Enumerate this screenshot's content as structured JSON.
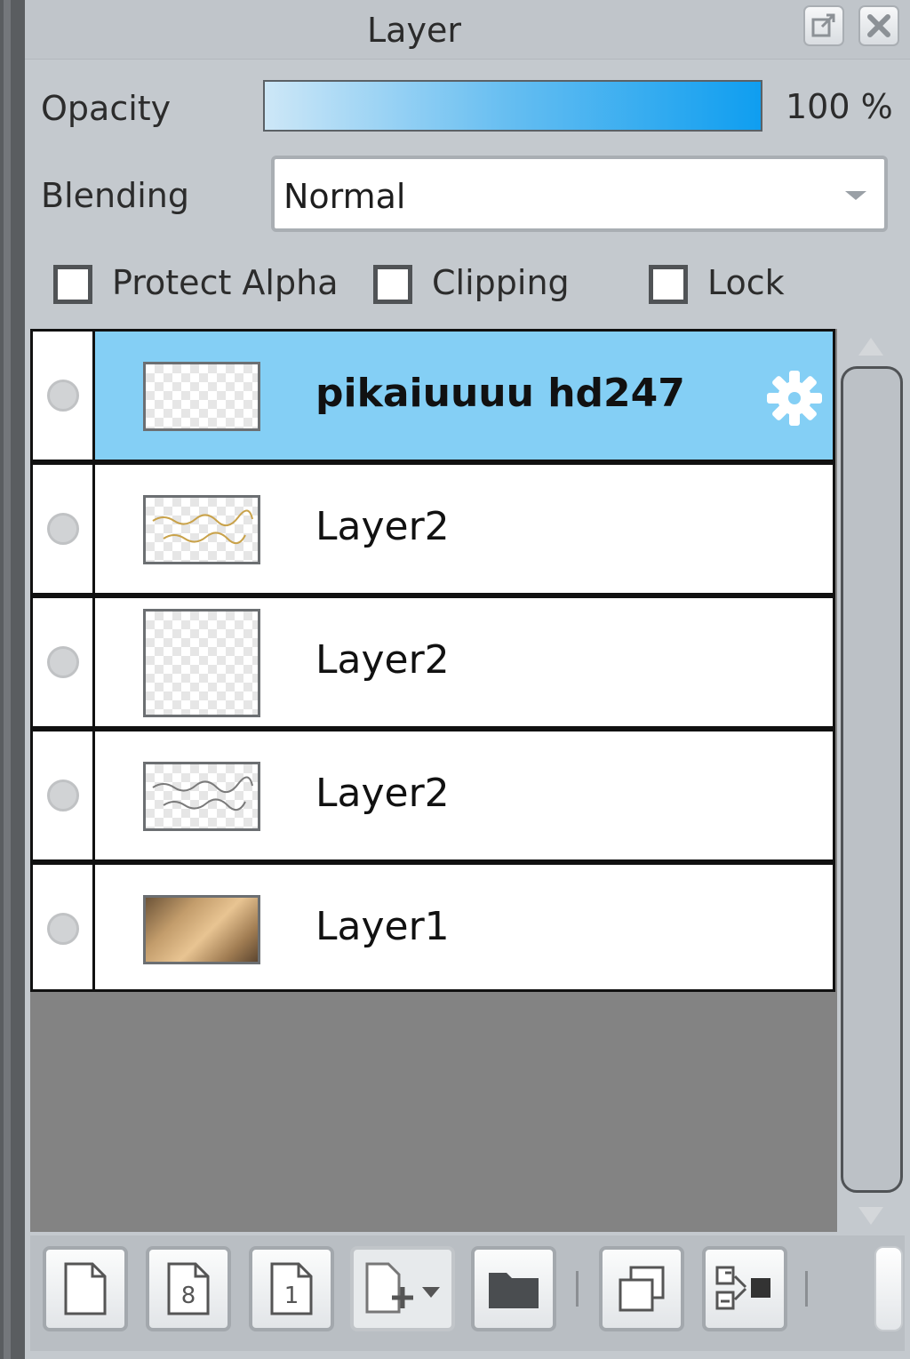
{
  "panel": {
    "title": "Layer",
    "popout_icon": "popout-icon",
    "close_icon": "close-icon"
  },
  "opacity": {
    "label": "Opacity",
    "value_text": "100 %",
    "percent": 100
  },
  "blending": {
    "label": "Blending",
    "selected": "Normal"
  },
  "options": {
    "protect_alpha": {
      "label": "Protect Alpha",
      "checked": false
    },
    "clipping": {
      "label": "Clipping",
      "checked": false
    },
    "lock": {
      "label": "Lock",
      "checked": false
    }
  },
  "layers": [
    {
      "name": "pikaiuuuu hd247",
      "selected": true,
      "thumbnail": "transparent",
      "settings_icon": "gear-icon"
    },
    {
      "name": "Layer2",
      "selected": false,
      "thumbnail": "handwriting-gold"
    },
    {
      "name": "Layer2",
      "selected": false,
      "thumbnail": "transparent"
    },
    {
      "name": "Layer2",
      "selected": false,
      "thumbnail": "handwriting-gray"
    },
    {
      "name": "Layer1",
      "selected": false,
      "thumbnail": "photo"
    }
  ],
  "toolbar": {
    "buttons": [
      "new-layer-icon",
      "new-8bit-layer-icon",
      "new-1bit-layer-icon",
      "add-layer-menu-icon",
      "new-folder-icon",
      "duplicate-layer-icon",
      "merge-layer-icon"
    ]
  },
  "colors": {
    "selected_row": "#84cff5",
    "opacity_gradient_end": "#0f9ef0"
  }
}
